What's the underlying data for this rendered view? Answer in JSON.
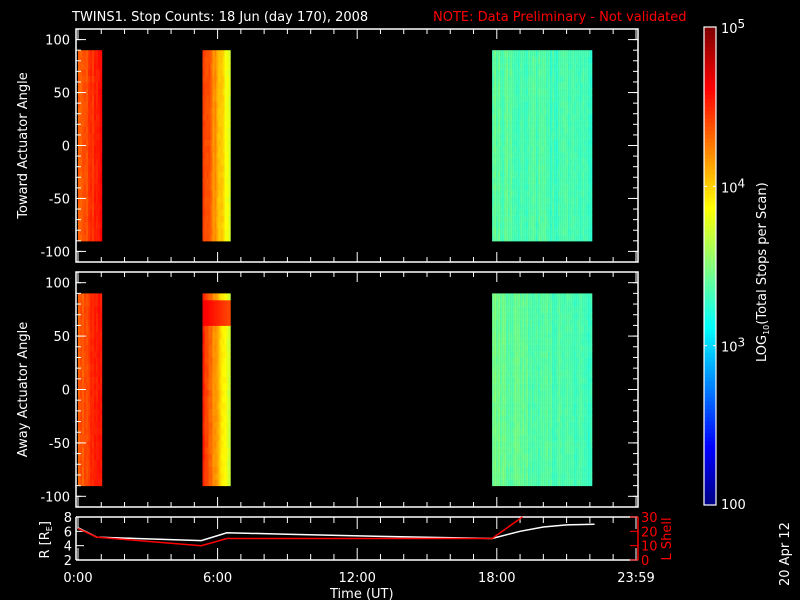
{
  "chart_data": {
    "type": "heatmap",
    "title": "TWINS1. Stop Counts: 18 Jun (day 170), 2008",
    "note": "NOTE: Data Preliminary - Not validated",
    "date_stamp": "20 Apr 12",
    "colors": {
      "note": "#ff0000",
      "axes": "#ffffff",
      "lshell": "#ff0000"
    },
    "xaxis": {
      "label": "Time (UT)",
      "range_hours": [
        0,
        23.983
      ],
      "tick_labels": [
        "0:00",
        "6:00",
        "12:00",
        "18:00",
        "23:59"
      ],
      "tick_hours": [
        0,
        6,
        12,
        18,
        23.983
      ]
    },
    "colorbar": {
      "label": "LOG10(Total Stops per Scan)",
      "label_main": "LOG",
      "label_sub": "10",
      "label_rest": "(Total Stops per Scan)",
      "log_range": [
        2,
        5
      ],
      "tick_labels": [
        "10",
        "10",
        "10",
        "100"
      ],
      "tick_exps": [
        "5",
        "4",
        "3",
        ""
      ],
      "tick_logs": [
        5,
        4,
        3,
        2
      ]
    },
    "panels": [
      {
        "ylabel": "Toward Actuator Angle",
        "ylim": [
          -110,
          110
        ],
        "angle_range": [
          -90,
          90
        ],
        "tick_labels": [
          "100",
          "50",
          "0",
          "-50",
          "-100"
        ],
        "ticks": [
          100,
          50,
          0,
          -50,
          -100
        ],
        "bands": [
          {
            "start_h": 0.0,
            "end_h": 1.0,
            "log_left": 4.35,
            "log_right": 4.6
          },
          {
            "start_h": 5.35,
            "end_h": 6.55,
            "log_left": 4.5,
            "log_right": 3.75
          },
          {
            "start_h": 17.8,
            "end_h": 22.05,
            "log_left": 3.4,
            "log_right": 3.3
          }
        ]
      },
      {
        "ylabel": "Away Actuator Angle",
        "ylim": [
          -110,
          110
        ],
        "angle_range": [
          -90,
          90
        ],
        "tick_labels": [
          "100",
          "50",
          "0",
          "-50",
          "-100"
        ],
        "ticks": [
          100,
          50,
          0,
          -50,
          -100
        ],
        "bands": [
          {
            "start_h": 0.0,
            "end_h": 1.0,
            "log_left": 4.35,
            "log_right": 4.6
          },
          {
            "start_h": 5.35,
            "end_h": 6.55,
            "log_left": 4.5,
            "log_right": 3.7,
            "hot_angle": [
              65,
              80
            ],
            "hot_log": 4.65
          },
          {
            "start_h": 17.8,
            "end_h": 22.05,
            "log_left": 3.45,
            "log_right": 3.3
          }
        ]
      }
    ],
    "orbit": {
      "left_label": "R [RE]",
      "left_label_main": "R [R",
      "left_label_sub": "E",
      "left_label_end": "]",
      "left_ylim": [
        2,
        8
      ],
      "left_ticks": [
        "8",
        "6",
        "4",
        "2"
      ],
      "right_label": "L Shell",
      "right_ylim": [
        0,
        30
      ],
      "right_ticks": [
        "30",
        "20",
        "10",
        "0"
      ],
      "series": [
        {
          "name": "R",
          "axis": "left",
          "x_hours": [
            0,
            0.8,
            2.5,
            5.3,
            6.4,
            9,
            13,
            17.8,
            19,
            20,
            21,
            22.2
          ],
          "y": [
            6.5,
            5.2,
            5.0,
            4.7,
            5.8,
            5.6,
            5.3,
            5.0,
            6.0,
            6.6,
            6.9,
            7.0
          ]
        },
        {
          "name": "L Shell",
          "axis": "right",
          "x_hours": [
            0,
            0.8,
            3,
            5.3,
            6.4,
            12,
            17.8,
            19.1
          ],
          "y": [
            22,
            16,
            13,
            10,
            15,
            15,
            15,
            30
          ]
        }
      ]
    }
  }
}
